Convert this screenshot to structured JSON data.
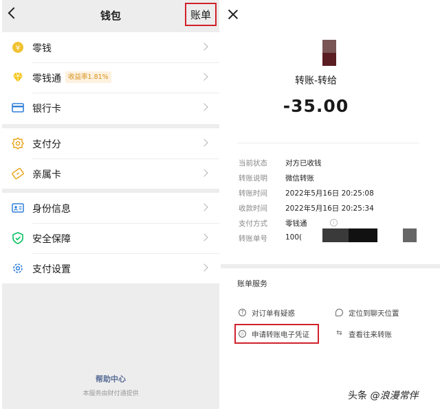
{
  "wallet": {
    "title": "钱包",
    "bill_button": "账单",
    "group1": [
      {
        "label": "零钱",
        "icon": "coin-icon"
      },
      {
        "label": "零钱通",
        "icon": "diamond-icon",
        "badge": "收益率1.81%"
      },
      {
        "label": "银行卡",
        "icon": "bank-card-icon"
      }
    ],
    "group2": [
      {
        "label": "支付分",
        "icon": "pay-score-icon"
      },
      {
        "label": "亲属卡",
        "icon": "family-card-icon"
      }
    ],
    "group3": [
      {
        "label": "身份信息",
        "icon": "id-card-icon"
      },
      {
        "label": "安全保障",
        "icon": "shield-icon"
      },
      {
        "label": "支付设置",
        "icon": "gear-icon"
      }
    ],
    "help_center": "帮助中心",
    "provider": "本服务由财付通提供",
    "colors": {
      "highlight": "#d0202a",
      "link": "#576b95",
      "accent_gold": "#e8b923",
      "accent_green": "#07c160"
    }
  },
  "bill_detail": {
    "title": "转账-转给",
    "amount": "-35.00",
    "fields": [
      {
        "key": "当前状态",
        "value": "对方已收钱"
      },
      {
        "key": "转账说明",
        "value": "微信转账"
      },
      {
        "key": "转账时间",
        "value": "2022年5月16日 20:25:08"
      },
      {
        "key": "收款时间",
        "value": "2022年5月16日 20:25:34"
      },
      {
        "key": "支付方式",
        "value": "零钱通"
      },
      {
        "key": "转账单号",
        "value": "100("
      }
    ],
    "services_title": "账单服务",
    "services": [
      {
        "label": "对订单有疑惑",
        "icon": "question-icon"
      },
      {
        "label": "定位到聊天位置",
        "icon": "chat-bubble-icon"
      },
      {
        "label": "申请转账电子凭证",
        "icon": "certificate-icon"
      },
      {
        "label": "查看往来转账",
        "icon": "transfer-arrows-icon"
      }
    ],
    "watermark": {
      "prefix": "头条",
      "handle": "@浪漫常伴"
    }
  }
}
